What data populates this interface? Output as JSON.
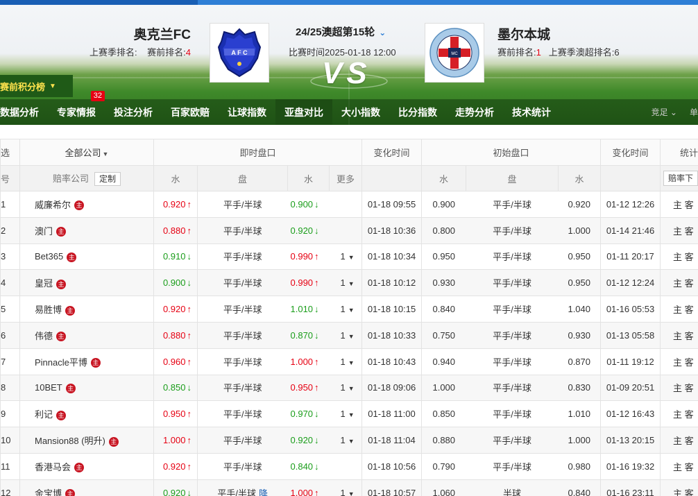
{
  "header": {
    "home": {
      "name": "奥克兰FC",
      "last_season_label": "上赛季排名:",
      "last_season_value": "",
      "pre_rank_label": "赛前排名:",
      "pre_rank_value": "4"
    },
    "away": {
      "name": "墨尔本城",
      "pre_rank_label": "赛前排名:",
      "pre_rank_value": "1",
      "last_season_label": "上赛季澳超排名:",
      "last_season_value": "6"
    },
    "round": "24/25澳超第15轮",
    "match_time": "比赛时间2025-01-18 12:00",
    "vs": "VS",
    "standings_btn": "赛前积分榜"
  },
  "nav": {
    "items": [
      {
        "label": "数据分析"
      },
      {
        "label": "专家情报",
        "badge": "32"
      },
      {
        "label": "投注分析"
      },
      {
        "label": "百家欧赔"
      },
      {
        "label": "让球指数"
      },
      {
        "label": "亚盘对比"
      },
      {
        "label": "大小指数"
      },
      {
        "label": "比分指数"
      },
      {
        "label": "走势分析"
      },
      {
        "label": "技术统计"
      }
    ],
    "right_1": "竞足",
    "right_2": "单"
  },
  "table": {
    "header1": {
      "select": "选",
      "all_company": "全部公司",
      "live": "即时盘口",
      "change_time": "变化时间",
      "initial": "初始盘口",
      "change_time2": "变化时间",
      "stats": "统计"
    },
    "header2": {
      "num": "号",
      "company": "赔率公司",
      "custom": "定制",
      "water1": "水",
      "handicap": "盘",
      "water2": "水",
      "more": "更多",
      "i_water1": "水",
      "i_handicap": "盘",
      "i_water2": "水",
      "odds_btn": "赔率下"
    },
    "rows": [
      {
        "num": "1",
        "company": "威廉希尔",
        "w1": "0.920",
        "w1_dir": "up",
        "hc": "平手/半球",
        "w2": "0.900",
        "w2_dir": "down",
        "more": "",
        "time": "01-18 09:55",
        "iw1": "0.900",
        "ihc": "平手/半球",
        "iw2": "0.920",
        "itime": "01-12 12:26",
        "hk": "主 客"
      },
      {
        "num": "2",
        "company": "澳门",
        "w1": "0.880",
        "w1_dir": "up",
        "hc": "平手/半球",
        "w2": "0.920",
        "w2_dir": "down",
        "more": "",
        "time": "01-18 10:36",
        "iw1": "0.800",
        "ihc": "平手/半球",
        "iw2": "1.000",
        "itime": "01-14 21:46",
        "hk": "主 客"
      },
      {
        "num": "3",
        "company": "Bet365",
        "w1": "0.910",
        "w1_dir": "down",
        "hc": "平手/半球",
        "w2": "0.990",
        "w2_dir": "up",
        "more": "1",
        "time": "01-18 10:34",
        "iw1": "0.950",
        "ihc": "平手/半球",
        "iw2": "0.950",
        "itime": "01-11 20:17",
        "hk": "主 客"
      },
      {
        "num": "4",
        "company": "皇冠",
        "w1": "0.900",
        "w1_dir": "down",
        "hc": "平手/半球",
        "w2": "0.990",
        "w2_dir": "up",
        "more": "1",
        "time": "01-18 10:12",
        "iw1": "0.930",
        "ihc": "平手/半球",
        "iw2": "0.950",
        "itime": "01-12 12:24",
        "hk": "主 客"
      },
      {
        "num": "5",
        "company": "易胜博",
        "w1": "0.920",
        "w1_dir": "up",
        "hc": "平手/半球",
        "w2": "1.010",
        "w2_dir": "down",
        "more": "1",
        "time": "01-18 10:15",
        "iw1": "0.840",
        "ihc": "平手/半球",
        "iw2": "1.040",
        "itime": "01-16 05:53",
        "hk": "主 客"
      },
      {
        "num": "6",
        "company": "伟德",
        "w1": "0.880",
        "w1_dir": "up",
        "hc": "平手/半球",
        "w2": "0.870",
        "w2_dir": "down",
        "more": "1",
        "time": "01-18 10:33",
        "iw1": "0.750",
        "ihc": "平手/半球",
        "iw2": "0.930",
        "itime": "01-13 05:58",
        "hk": "主 客"
      },
      {
        "num": "7",
        "company": "Pinnacle平博",
        "w1": "0.960",
        "w1_dir": "up",
        "hc": "平手/半球",
        "w2": "1.000",
        "w2_dir": "up",
        "more": "1",
        "time": "01-18 10:43",
        "iw1": "0.940",
        "ihc": "平手/半球",
        "iw2": "0.870",
        "itime": "01-11 19:12",
        "hk": "主 客"
      },
      {
        "num": "8",
        "company": "10BET",
        "w1": "0.850",
        "w1_dir": "down",
        "hc": "平手/半球",
        "w2": "0.950",
        "w2_dir": "up",
        "more": "1",
        "time": "01-18 09:06",
        "iw1": "1.000",
        "ihc": "平手/半球",
        "iw2": "0.830",
        "itime": "01-09 20:51",
        "hk": "主 客"
      },
      {
        "num": "9",
        "company": "利记",
        "w1": "0.950",
        "w1_dir": "up",
        "hc": "平手/半球",
        "w2": "0.970",
        "w2_dir": "down",
        "more": "1",
        "time": "01-18 11:00",
        "iw1": "0.850",
        "ihc": "平手/半球",
        "iw2": "1.010",
        "itime": "01-12 16:43",
        "hk": "主 客"
      },
      {
        "num": "10",
        "company": "Mansion88 (明升)",
        "w1": "1.000",
        "w1_dir": "up",
        "hc": "平手/半球",
        "w2": "0.920",
        "w2_dir": "down",
        "more": "1",
        "time": "01-18 11:04",
        "iw1": "0.880",
        "ihc": "平手/半球",
        "iw2": "1.000",
        "itime": "01-13 20:15",
        "hk": "主 客"
      },
      {
        "num": "11",
        "company": "香港马会",
        "w1": "0.920",
        "w1_dir": "up",
        "hc": "平手/半球",
        "w2": "0.840",
        "w2_dir": "down",
        "more": "",
        "time": "01-18 10:56",
        "iw1": "0.790",
        "ihc": "平手/半球",
        "iw2": "0.980",
        "itime": "01-16 19:32",
        "hk": "主 客"
      },
      {
        "num": "12",
        "company": "金宝博",
        "w1": "0.920",
        "w1_dir": "down",
        "hc": "平手/半球",
        "hc_extra": "降",
        "w2": "1.000",
        "w2_dir": "up",
        "more": "1",
        "time": "01-18 10:57",
        "iw1": "1.060",
        "ihc": "半球",
        "iw2": "0.840",
        "itime": "01-16 23:11",
        "hk": "主 客"
      }
    ],
    "host_icon_text": "主"
  },
  "colors": {
    "up": "#e60012",
    "down": "#1a9d1a",
    "accent": "#2f7fd6",
    "nav_bg": "#1d4d14"
  },
  "icons": {
    "up_arrow": "arrow-up-icon",
    "down_arrow": "arrow-down-icon",
    "host": "host-badge-icon",
    "caret": "caret-down-icon"
  }
}
